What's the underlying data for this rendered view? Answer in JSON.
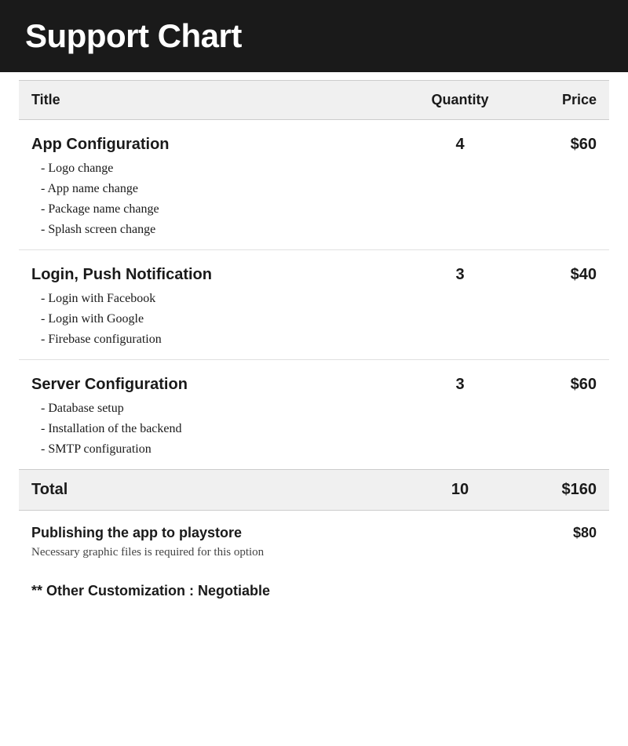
{
  "header": {
    "title": "Support Chart"
  },
  "table": {
    "columns": {
      "title": "Title",
      "quantity": "Quantity",
      "price": "Price"
    },
    "sections": [
      {
        "id": "app-configuration",
        "title": "App Configuration",
        "quantity": "4",
        "price": "$60",
        "items": [
          "- Logo change",
          "- App name change",
          "- Package name change",
          "- Splash screen change"
        ]
      },
      {
        "id": "login-push-notification",
        "title": "Login, Push Notification",
        "quantity": "3",
        "price": "$40",
        "items": [
          "- Login with Facebook",
          "- Login with Google",
          "- Firebase configuration"
        ]
      },
      {
        "id": "server-configuration",
        "title": "Server Configuration",
        "quantity": "3",
        "price": "$60",
        "items": [
          "- Database setup",
          "- Installation of the backend",
          "- SMTP configuration"
        ]
      }
    ],
    "total": {
      "label": "Total",
      "quantity": "10",
      "price": "$160"
    },
    "publishing": {
      "label": "Publishing the app to playstore",
      "price": "$80",
      "note": "Necessary graphic files is required for this option"
    },
    "other": {
      "label": "** Other Customization : Negotiable"
    }
  }
}
